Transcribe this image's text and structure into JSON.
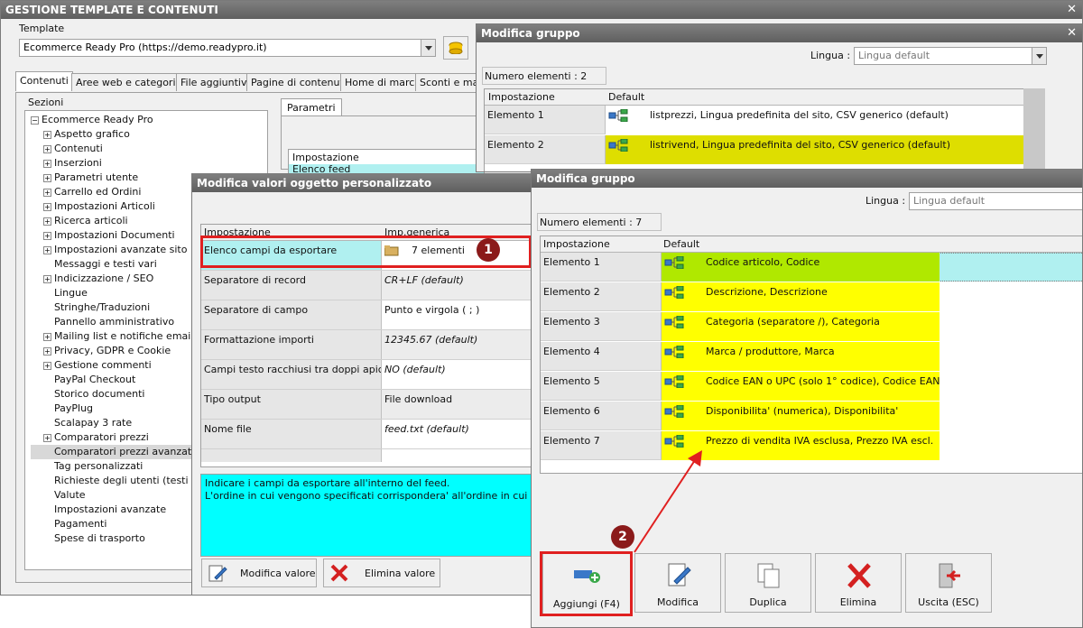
{
  "main_window": {
    "title": "GESTIONE TEMPLATE E CONTENUTI",
    "template_label": "Template",
    "template_value": "Ecommerce Ready Pro (https://demo.readypro.it)",
    "tabs": [
      "Contenuti",
      "Aree web e categorie",
      "File aggiuntivi",
      "Pagine di contenuti",
      "Home di marca",
      "Sconti e mag"
    ],
    "sections_label": "Sezioni",
    "tree_root": "Ecommerce Ready Pro",
    "tree_items": [
      {
        "label": "Aspetto grafico",
        "expandable": true
      },
      {
        "label": "Contenuti",
        "expandable": true
      },
      {
        "label": "Inserzioni",
        "expandable": true
      },
      {
        "label": "Parametri utente",
        "expandable": true
      },
      {
        "label": "Carrello ed Ordini",
        "expandable": true
      },
      {
        "label": "Impostazioni Articoli",
        "expandable": true
      },
      {
        "label": "Ricerca articoli",
        "expandable": true
      },
      {
        "label": "Impostazioni Documenti",
        "expandable": true
      },
      {
        "label": "Impostazioni avanzate sito",
        "expandable": true
      },
      {
        "label": "Messaggi e testi vari",
        "expandable": false
      },
      {
        "label": "Indicizzazione / SEO",
        "expandable": true
      },
      {
        "label": "Lingue",
        "expandable": false
      },
      {
        "label": "Stringhe/Traduzioni",
        "expandable": false
      },
      {
        "label": "Pannello amministrativo",
        "expandable": false
      },
      {
        "label": "Mailing list e notifiche email",
        "expandable": true
      },
      {
        "label": "Privacy, GDPR e Cookie",
        "expandable": true
      },
      {
        "label": "Gestione commenti",
        "expandable": true
      },
      {
        "label": "PayPal Checkout",
        "expandable": false
      },
      {
        "label": "Storico documenti",
        "expandable": false
      },
      {
        "label": "PayPlug",
        "expandable": false
      },
      {
        "label": "Scalapay 3 rate",
        "expandable": false
      },
      {
        "label": "Comparatori prezzi",
        "expandable": true
      },
      {
        "label": "Comparatori prezzi avanzato",
        "expandable": false
      },
      {
        "label": "Tag personalizzati",
        "expandable": false
      },
      {
        "label": "Richieste degli utenti (testi delle",
        "expandable": false
      },
      {
        "label": "Valute",
        "expandable": false
      },
      {
        "label": "Impostazioni avanzate",
        "expandable": false
      },
      {
        "label": "Pagamenti",
        "expandable": false
      },
      {
        "label": "Spese di trasporto",
        "expandable": false
      }
    ],
    "params_tab": "Parametri",
    "params_header": "Impostazione",
    "params_row": "Elenco feed"
  },
  "dialog_values": {
    "title": "Modifica valori oggetto personalizzato",
    "col_setting": "Impostazione",
    "col_value": "Imp.generica",
    "rows": [
      {
        "setting": "Elenco campi da esportare",
        "value": "7 elementi",
        "italic": false,
        "highlight": true
      },
      {
        "setting": "Separatore di record",
        "value": "CR+LF (default)",
        "italic": true
      },
      {
        "setting": "Separatore di campo",
        "value": "Punto e virgola ( ; )",
        "italic": false
      },
      {
        "setting": "Formattazione importi",
        "value": "12345.67 (default)",
        "italic": true
      },
      {
        "setting": "Campi testo racchiusi tra doppi apici",
        "value": "NO (default)",
        "italic": true
      },
      {
        "setting": "Tipo output",
        "value": "File download",
        "italic": false
      },
      {
        "setting": "Nome file",
        "value": "feed.txt (default)",
        "italic": true
      }
    ],
    "description_line1": "Indicare i campi da esportare all'interno del feed.",
    "description_line2": "L'ordine in cui vengono specificati corrispondera' all'ordine in cui verranno es",
    "btn_modify": "Modifica valore",
    "btn_delete": "Elimina valore",
    "badge": "1"
  },
  "group_back": {
    "title": "Modifica gruppo",
    "language_label": "Lingua :",
    "language_value": "Lingua default",
    "count": "Numero elementi : 2",
    "col_setting": "Impostazione",
    "col_default": "Default",
    "rows": [
      {
        "label": "Elemento 1",
        "value": "listprezzi, Lingua predefinita del sito, CSV generico (default)"
      },
      {
        "label": "Elemento 2",
        "value": "listrivend, Lingua predefinita del sito, CSV generico (default)"
      }
    ]
  },
  "group_front": {
    "title": "Modifica gruppo",
    "language_label": "Lingua :",
    "language_value": "Lingua default",
    "count": "Numero elementi : 7",
    "col_setting": "Impostazione",
    "col_default": "Default",
    "rows": [
      {
        "label": "Elemento 1",
        "value": "Codice articolo, Codice"
      },
      {
        "label": "Elemento 2",
        "value": "Descrizione, Descrizione"
      },
      {
        "label": "Elemento 3",
        "value": "Categoria (separatore /), Categoria"
      },
      {
        "label": "Elemento 4",
        "value": "Marca / produttore, Marca"
      },
      {
        "label": "Elemento 5",
        "value": "Codice EAN o UPC (solo 1° codice), Codice EAN/UPC"
      },
      {
        "label": "Elemento 6",
        "value": "Disponibilita' (numerica), Disponibilita'"
      },
      {
        "label": "Elemento 7",
        "value": "Prezzo di vendita IVA esclusa, Prezzo IVA escl."
      }
    ],
    "buttons": {
      "add": "Aggiungi (F4)",
      "modify": "Modifica",
      "duplicate": "Duplica",
      "delete": "Elimina",
      "exit": "Uscita (ESC)"
    },
    "badge": "2"
  },
  "colors": {
    "titlebar": "#6f6f6f",
    "highlight_red": "#e02020",
    "yellow": "#ffff00",
    "lime": "#b0e800",
    "olive": "#dede00",
    "cyan": "#00ffff",
    "light_cyan": "#b0f0f0"
  }
}
